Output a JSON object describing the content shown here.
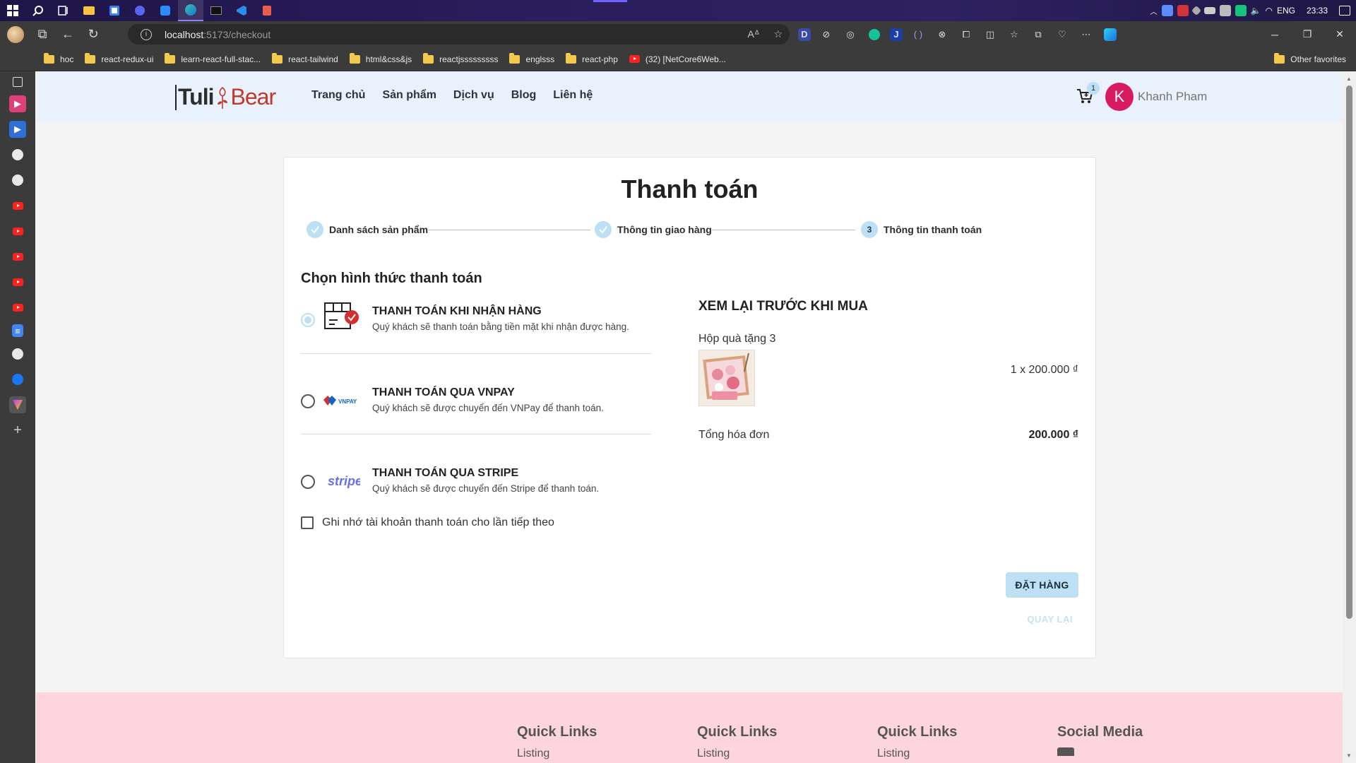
{
  "taskbar": {
    "language": "ENG",
    "time": "23:33"
  },
  "browser": {
    "url_host": "localhost",
    "url_path": ":5173/checkout",
    "bookmarks": [
      {
        "label": "hoc",
        "type": "folder"
      },
      {
        "label": "react-redux-ui",
        "type": "folder"
      },
      {
        "label": "learn-react-full-stac...",
        "type": "folder"
      },
      {
        "label": "react-tailwind",
        "type": "folder"
      },
      {
        "label": "html&css&js",
        "type": "folder"
      },
      {
        "label": "reactjsssssssss",
        "type": "folder"
      },
      {
        "label": "englsss",
        "type": "folder"
      },
      {
        "label": "react-php",
        "type": "folder"
      },
      {
        "label": "(32) [NetCore6Web...",
        "type": "youtube"
      }
    ],
    "other_favorites": "Other favorites",
    "extension_d_label": "D",
    "extension_j_label": "J"
  },
  "header": {
    "logo_left": "Tuli",
    "logo_right": "Bear",
    "nav": [
      "Trang chủ",
      "Sản phẩm",
      "Dịch vụ",
      "Blog",
      "Liên hệ"
    ],
    "cart_count": "1",
    "user_initial": "K",
    "user_name": "Khanh Pham"
  },
  "checkout": {
    "title": "Thanh toán",
    "steps": [
      {
        "label": "Danh sách sản phẩm",
        "state": "done"
      },
      {
        "label": "Thông tin giao hàng",
        "state": "done"
      },
      {
        "label": "Thông tin thanh toán",
        "state": "active",
        "number": "3"
      }
    ],
    "payment_heading": "Chọn hình thức thanh toán",
    "payment_methods": [
      {
        "title": "THANH TOÁN KHI NHẬN HÀNG",
        "desc": "Quý khách sẽ thanh toán bằng tiền mặt khi nhận được hàng.",
        "selected": true,
        "icon": "cod-box-icon"
      },
      {
        "title": "THANH TOÁN QUA VNPAY",
        "desc": "Quý khách sẽ được chuyển đến VNPay để thanh toán.",
        "selected": false,
        "icon": "vnpay-logo-icon",
        "logo_text": "VNPAY"
      },
      {
        "title": "THANH TOÁN QUA STRIPE",
        "desc": "Quý khách sẽ được chuyển đến Stripe để thanh toán.",
        "selected": false,
        "icon": "stripe-logo-icon",
        "logo_text": "stripe"
      }
    ],
    "remember_label": "Ghi nhớ tài khoản thanh toán cho lần tiếp theo",
    "review_title": "XEM LẠI TRƯỚC KHI MUA",
    "item": {
      "name": "Hộp quà tặng 3",
      "qty_price": "1 x  200.000 ₫"
    },
    "total_label": "Tổng hóa đơn",
    "total_value": "200.000 ₫",
    "order_button": "ĐẶT HÀNG",
    "back_button": "QUAY LẠI"
  },
  "footer": {
    "columns": [
      {
        "title": "Quick Links",
        "first": "Listing"
      },
      {
        "title": "Quick Links",
        "first": "Listing"
      },
      {
        "title": "Quick Links",
        "first": "Listing"
      },
      {
        "title": "Social Media",
        "first": ""
      }
    ]
  },
  "colors": {
    "accent": "#bde0f5",
    "header_bg": "#e8f1fc",
    "footer_bg": "#fcd5de",
    "avatar": "#d81b60"
  }
}
